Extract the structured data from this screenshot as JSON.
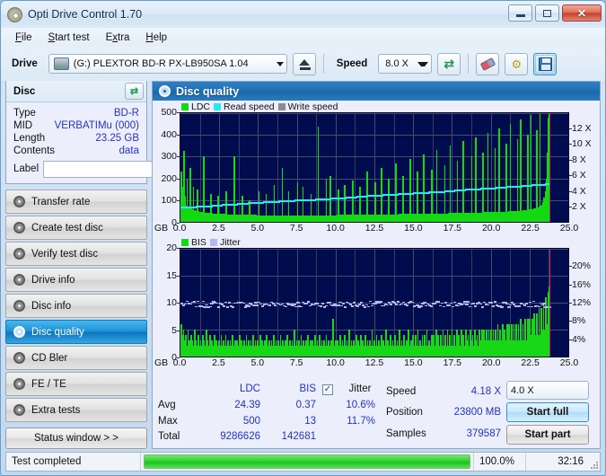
{
  "window": {
    "title": "Opti Drive Control 1.70",
    "app_icon": "disc-icon",
    "minimize_label": "",
    "maximize_label": "",
    "close_label": "✕"
  },
  "menu": [
    {
      "label": "File",
      "accel": "F"
    },
    {
      "label": "Start test",
      "accel": "S"
    },
    {
      "label": "Extra",
      "accel": "x"
    },
    {
      "label": "Help",
      "accel": "H"
    }
  ],
  "toolbar": {
    "drive_label": "Drive",
    "drive_value": "(G:)  PLEXTOR BD-R  PX-LB950SA 1.04",
    "drive_icon": "drive-icon",
    "eject_icon": "eject-icon",
    "speed_label": "Speed",
    "speed_value": "8.0 X",
    "refresh_icon": "refresh-icon",
    "erase_icon": "eraser-icon",
    "tools_icon": "tools-icon",
    "save_icon": "save-icon"
  },
  "disc": {
    "panel_title": "Disc",
    "refresh_icon": "refresh-icon",
    "rows": [
      {
        "key": "Type",
        "value": "BD-R"
      },
      {
        "key": "MID",
        "value": "VERBATIMu (000)"
      },
      {
        "key": "Length",
        "value": "23.25 GB"
      },
      {
        "key": "Contents",
        "value": "data"
      }
    ],
    "label_key": "Label",
    "label_value": "",
    "label_placeholder": "",
    "disc_button_icon": "cd-icon"
  },
  "sidebar": {
    "items": [
      {
        "label": "Transfer rate",
        "icon": "disc-transfer-icon",
        "selected": false
      },
      {
        "label": "Create test disc",
        "icon": "disc-create-icon",
        "selected": false
      },
      {
        "label": "Verify test disc",
        "icon": "disc-verify-icon",
        "selected": false
      },
      {
        "label": "Drive info",
        "icon": "drive-info-icon",
        "selected": false
      },
      {
        "label": "Disc info",
        "icon": "disc-info-icon",
        "selected": false
      },
      {
        "label": "Disc quality",
        "icon": "disc-quality-icon",
        "selected": true
      },
      {
        "label": "CD Bler",
        "icon": "disc-bler-icon",
        "selected": false
      },
      {
        "label": "FE / TE",
        "icon": "disc-fete-icon",
        "selected": false
      },
      {
        "label": "Extra tests",
        "icon": "disc-extra-icon",
        "selected": false
      }
    ],
    "status_window_button": "Status window > >"
  },
  "main": {
    "header_title": "Disc quality",
    "header_icon": "disc-quality-icon"
  },
  "colors": {
    "ldc": "#12d912",
    "read_speed": "#28e8f4",
    "write_speed": "#8c8c8c",
    "bis": "#17d717",
    "jitter": "#b4b8f0",
    "plot_bg": "#000c4d",
    "accent": "#1f6fb4",
    "value_text": "#2135c8"
  },
  "chart_data": [
    {
      "type": "bar",
      "title": "Disc quality - LDC",
      "xlabel": "GB",
      "ylabel": "LDC",
      "legend": [
        {
          "label": "LDC",
          "color": "#12d912"
        },
        {
          "label": "Read speed",
          "color": "#28e8f4"
        },
        {
          "label": "Write speed",
          "color": "#8c8c8c"
        }
      ],
      "legend_position": "top-left",
      "grid": true,
      "xlim": [
        0,
        25.0
      ],
      "xticks": [
        "0.0",
        "2.5",
        "5.0",
        "7.5",
        "10.0",
        "12.5",
        "15.0",
        "17.5",
        "20.0",
        "22.5",
        "25.0"
      ],
      "xunit": "GB",
      "ylim": [
        0,
        500
      ],
      "yticks": [
        0,
        100,
        200,
        300,
        400,
        500
      ],
      "y2lim": [
        0,
        13
      ],
      "y2ticks": [
        "2 X",
        "4 X",
        "6 X",
        "8 X",
        "10 X",
        "12 X"
      ],
      "data_end_gb": 23.8,
      "series": [
        {
          "name": "LDC",
          "color": "#12d912",
          "values": [
            230,
            160,
            95,
            325,
            120,
            75,
            200,
            70,
            65,
            250,
            60,
            58,
            160,
            55,
            52,
            50,
            150,
            48,
            46,
            45,
            44,
            44,
            300,
            43,
            42,
            42,
            41,
            41,
            40,
            130,
            40,
            39,
            39,
            38,
            38,
            38,
            120,
            37,
            37,
            37,
            36,
            36,
            36,
            36,
            140,
            35,
            35,
            35,
            35,
            35,
            34,
            34,
            300,
            34,
            34,
            34,
            33,
            33,
            33,
            33,
            120,
            33,
            33,
            33,
            32,
            32,
            32,
            100,
            32,
            32,
            32,
            32,
            32,
            32,
            31,
            31,
            140,
            31,
            31,
            31,
            31,
            31,
            31,
            130,
            31,
            31,
            31,
            31,
            30,
            30,
            30,
            170,
            30,
            30,
            30,
            30,
            30,
            30,
            30,
            250,
            30,
            30,
            30,
            30,
            30,
            140,
            30,
            30,
            30,
            30,
            30,
            30,
            30,
            30,
            180,
            30,
            30,
            30,
            30,
            160,
            30,
            30,
            30,
            30,
            30,
            30,
            30,
            130,
            30,
            30,
            30,
            30,
            30,
            30,
            440,
            30,
            30,
            30,
            31,
            31,
            31,
            31,
            200,
            31,
            31,
            31,
            210,
            31,
            31,
            31,
            31,
            31,
            31,
            32,
            150,
            32,
            32,
            32,
            32,
            32,
            170,
            32,
            32,
            32,
            32,
            32,
            32,
            32,
            190,
            32,
            33,
            33,
            33,
            33,
            33,
            160,
            33,
            33,
            33,
            33,
            33,
            33,
            230,
            33,
            34,
            34,
            34,
            34,
            34,
            34,
            180,
            34,
            34,
            34,
            34,
            34,
            250,
            34,
            35,
            35,
            35,
            35,
            35,
            200,
            35,
            35,
            35,
            35,
            35,
            35,
            270,
            35,
            35,
            36,
            36,
            36,
            36,
            210,
            36,
            36,
            36,
            36,
            36,
            36,
            290,
            36,
            36,
            37,
            37,
            37,
            37,
            230,
            37,
            37,
            37,
            37,
            37,
            310,
            37,
            37,
            38,
            38,
            38,
            38,
            38,
            240,
            38,
            38,
            38,
            38,
            330,
            38,
            39,
            39,
            39,
            39,
            39,
            39,
            260,
            39,
            39,
            39,
            40,
            350,
            40,
            40,
            40,
            40,
            40,
            40,
            280,
            40,
            41,
            41,
            41,
            41,
            370,
            41,
            41,
            41,
            41,
            42,
            42,
            42,
            300,
            42,
            42,
            42,
            390,
            42,
            43,
            43,
            43,
            43,
            43,
            320,
            43,
            44,
            44,
            44,
            410,
            44,
            44,
            44,
            45,
            45,
            45,
            340,
            45,
            45,
            46,
            430,
            46,
            46,
            46,
            47,
            47,
            47,
            360,
            47,
            48,
            48,
            450,
            48,
            48,
            49,
            49,
            49,
            50,
            380,
            50,
            51,
            470,
            51,
            52,
            52,
            53,
            53,
            54,
            400,
            55,
            56,
            490,
            57,
            58,
            60,
            62,
            64,
            420,
            66,
            70,
            500,
            75,
            80,
            90,
            110,
            140,
            200,
            320,
            480,
            500
          ]
        },
        {
          "name": "Read speed",
          "color": "#28e8f4",
          "unit": "X",
          "points": [
            {
              "x": 0.0,
              "y": 1.8
            },
            {
              "x": 2.0,
              "y": 2.0
            },
            {
              "x": 4.0,
              "y": 2.3
            },
            {
              "x": 6.0,
              "y": 2.5
            },
            {
              "x": 8.0,
              "y": 2.7
            },
            {
              "x": 10.0,
              "y": 2.9
            },
            {
              "x": 12.0,
              "y": 3.2
            },
            {
              "x": 14.0,
              "y": 3.4
            },
            {
              "x": 16.0,
              "y": 3.6
            },
            {
              "x": 18.0,
              "y": 3.9
            },
            {
              "x": 20.0,
              "y": 4.1
            },
            {
              "x": 22.0,
              "y": 4.4
            },
            {
              "x": 23.8,
              "y": 4.6
            }
          ]
        }
      ]
    },
    {
      "type": "bar",
      "title": "Disc quality - BIS",
      "xlabel": "GB",
      "ylabel": "BIS",
      "legend": [
        {
          "label": "BIS",
          "color": "#17d717"
        },
        {
          "label": "Jitter",
          "color": "#b4b8f0"
        }
      ],
      "legend_position": "top-left",
      "grid": true,
      "xlim": [
        0,
        25.0
      ],
      "xticks": [
        "0.0",
        "2.5",
        "5.0",
        "7.5",
        "10.0",
        "12.5",
        "15.0",
        "17.5",
        "20.0",
        "22.5",
        "25.0"
      ],
      "xunit": "GB",
      "ylim": [
        0,
        20
      ],
      "yticks": [
        0,
        5,
        10,
        15,
        20
      ],
      "y2lim": [
        0,
        22
      ],
      "y2ticks": [
        "4%",
        "8%",
        "12%",
        "16%",
        "20%"
      ],
      "data_end_gb": 23.8,
      "series": [
        {
          "name": "BIS",
          "color": "#17d717",
          "values": [
            6,
            4,
            5,
            3,
            4,
            2,
            5,
            3,
            2,
            4,
            3,
            2,
            5,
            3,
            2,
            4,
            2,
            3,
            2,
            4,
            3,
            2,
            5,
            3,
            2,
            4,
            2,
            3,
            2,
            4,
            2,
            3,
            2,
            3,
            2,
            4,
            2,
            3,
            2,
            4,
            2,
            3,
            2,
            3,
            2,
            4,
            2,
            3,
            2,
            3,
            2,
            4,
            2,
            3,
            2,
            3,
            2,
            4,
            2,
            3,
            2,
            3,
            2,
            4,
            2,
            3,
            2,
            3,
            2,
            4,
            2,
            3,
            2,
            3,
            2,
            4,
            2,
            3,
            2,
            3,
            2,
            4,
            2,
            3,
            2,
            3,
            2,
            4,
            2,
            3,
            2,
            3,
            2,
            4,
            2,
            3,
            2,
            3,
            2,
            5,
            2,
            3,
            2,
            3,
            2,
            4,
            2,
            3,
            2,
            3,
            2,
            4,
            2,
            3,
            2,
            3,
            2,
            4,
            2,
            3,
            2,
            4,
            2,
            3,
            2,
            3,
            2,
            4,
            2,
            3,
            2,
            3,
            2,
            7,
            2,
            3,
            2,
            3,
            2,
            4,
            2,
            3,
            2,
            4,
            2,
            3,
            2,
            5,
            2,
            3,
            2,
            3,
            2,
            4,
            2,
            3,
            2,
            4,
            2,
            3,
            2,
            4,
            2,
            3,
            2,
            3,
            2,
            5,
            2,
            3,
            2,
            4,
            2,
            3,
            2,
            4,
            2,
            3,
            2,
            5,
            2,
            3,
            2,
            4,
            2,
            3,
            2,
            4,
            2,
            3,
            2,
            5,
            2,
            3,
            2,
            4,
            2,
            3,
            2,
            5,
            2,
            3,
            2,
            4,
            2,
            4,
            2,
            5,
            2,
            3,
            2,
            4,
            2,
            4,
            2,
            5,
            2,
            3,
            2,
            4,
            2,
            4,
            2,
            5,
            2,
            4,
            2,
            4,
            2,
            5,
            2,
            4,
            2,
            5,
            2,
            4,
            2,
            5,
            2,
            4,
            2,
            5,
            2,
            4,
            2,
            5,
            2,
            4,
            2,
            5,
            3,
            4,
            2,
            5,
            3,
            4,
            2,
            5,
            3,
            4,
            2,
            5,
            3,
            5,
            2,
            5,
            3,
            5,
            3,
            5,
            3,
            5,
            3,
            5,
            3,
            5,
            3,
            6,
            3,
            5,
            3,
            6,
            3,
            5,
            3,
            6,
            3,
            6,
            3,
            6,
            3,
            6,
            3,
            6,
            3,
            6,
            3,
            7,
            3,
            6,
            3,
            7,
            3,
            7,
            3,
            7,
            4,
            7,
            4,
            8,
            4,
            8,
            4,
            9,
            4,
            9,
            5,
            10,
            5,
            11,
            6,
            12,
            13
          ]
        },
        {
          "name": "Jitter",
          "color": "#b4b8f0",
          "unit": "%",
          "baseline": 10.8,
          "noise_amplitude": 0.6,
          "range": [
            10.0,
            11.7
          ]
        }
      ]
    }
  ],
  "results": {
    "columns": [
      "LDC",
      "BIS"
    ],
    "jitter_label": "Jitter",
    "jitter_checked": true,
    "rows": [
      {
        "label": "Avg",
        "ldc": "24.39",
        "bis": "0.37",
        "jitter": "10.6%"
      },
      {
        "label": "Max",
        "ldc": "500",
        "bis": "13",
        "jitter": "11.7%"
      },
      {
        "label": "Total",
        "ldc": "9286626",
        "bis": "142681",
        "jitter": ""
      }
    ],
    "metrics": [
      {
        "label": "Speed",
        "value": "4.18 X"
      },
      {
        "label": "Position",
        "value": "23800 MB"
      },
      {
        "label": "Samples",
        "value": "379587"
      }
    ],
    "speed_select": "4.0 X",
    "start_full_button": "Start full",
    "start_part_button": "Start part"
  },
  "statusbar": {
    "message": "Test completed",
    "progress_percent": "100.0%",
    "progress_value": 100,
    "elapsed": "32:16"
  }
}
